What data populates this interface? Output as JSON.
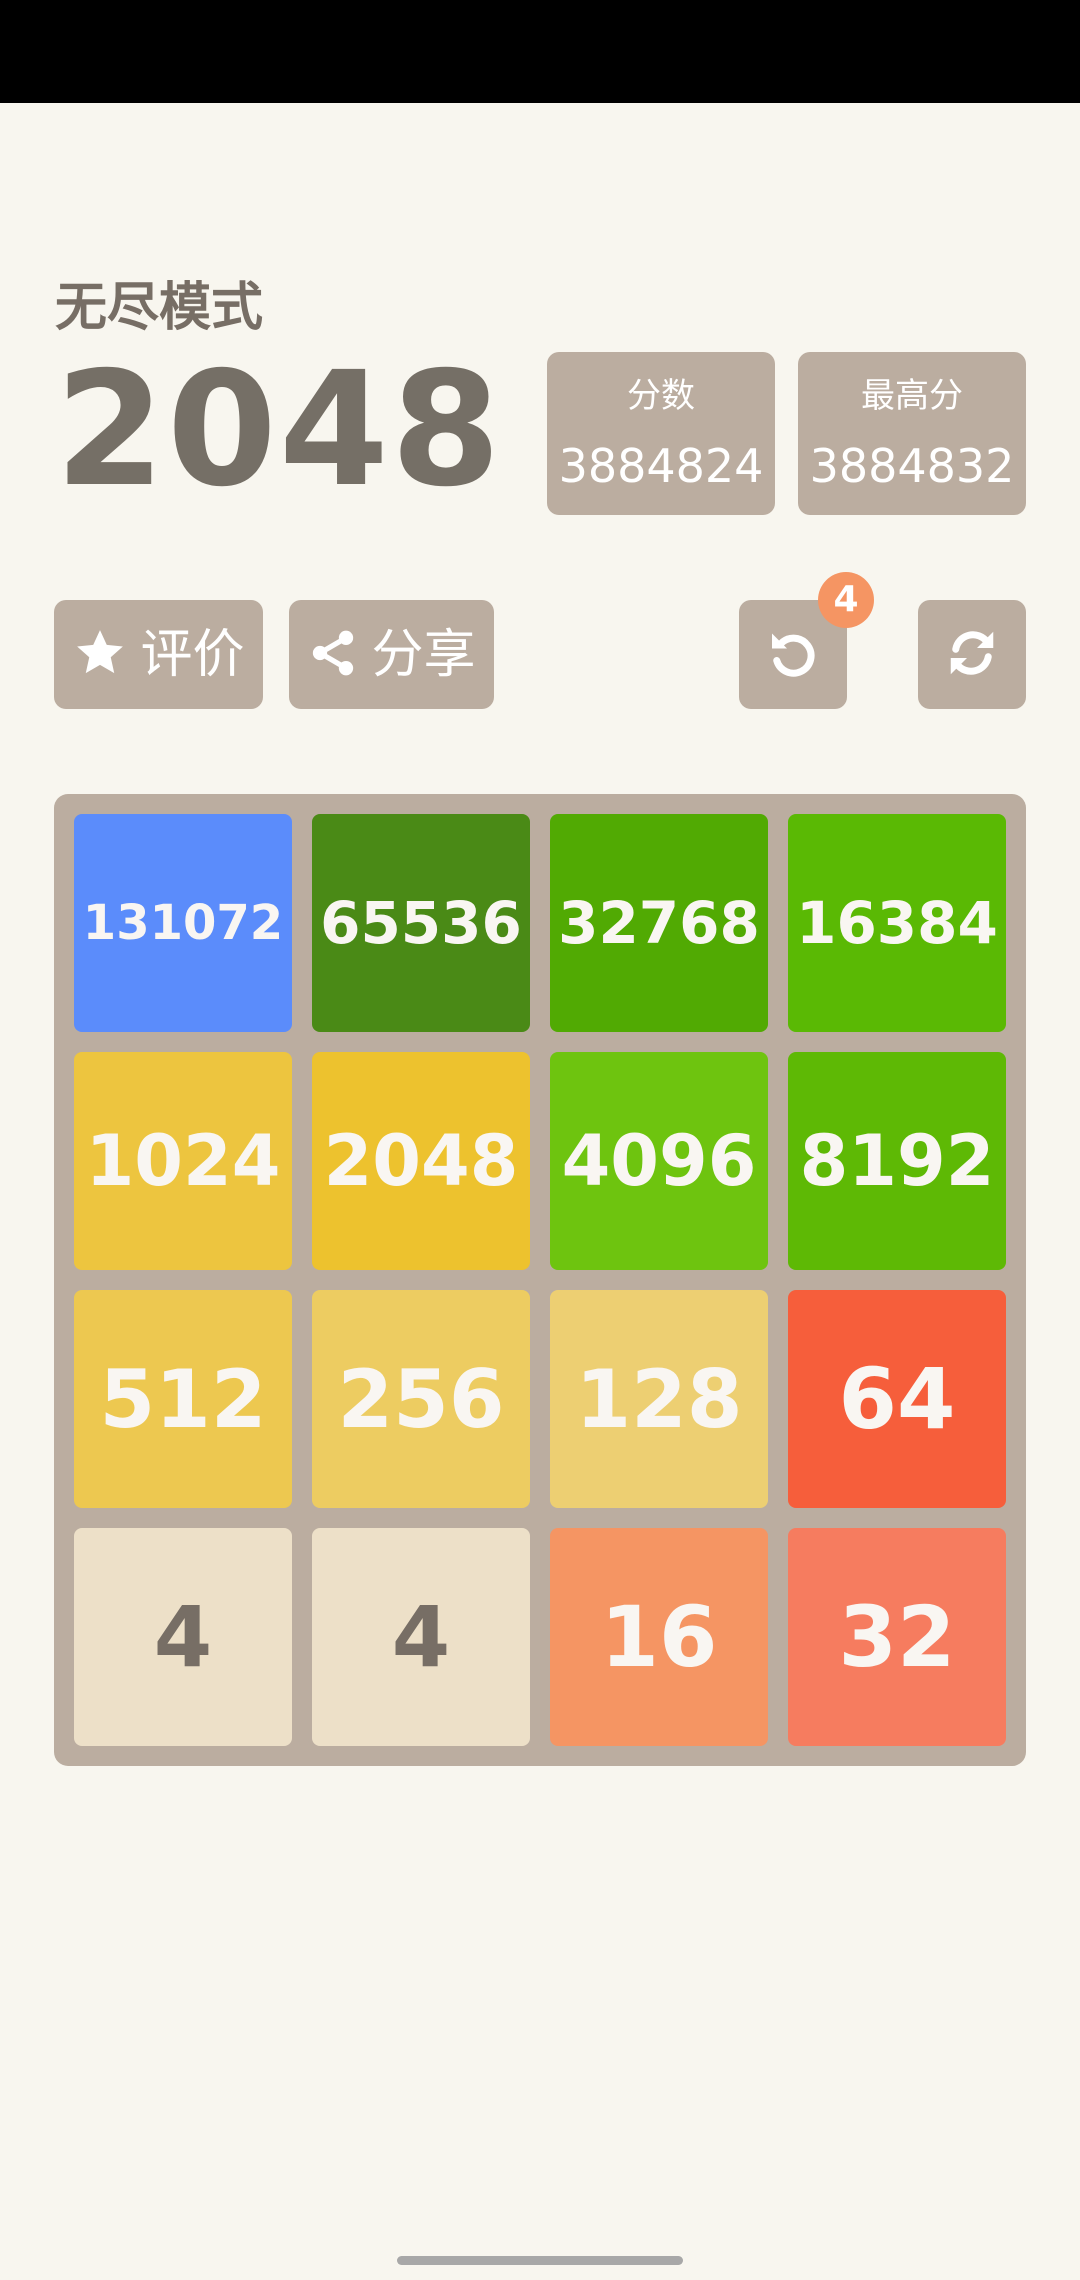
{
  "header": {
    "mode_label": "无尽模式",
    "title": "2048",
    "score": {
      "label": "分数",
      "value": "3884824"
    },
    "best": {
      "label": "最高分",
      "value": "3884832"
    }
  },
  "toolbar": {
    "rate_label": "评价",
    "share_label": "分享",
    "undo_badge": "4",
    "icons": [
      "star-icon",
      "share-icon",
      "undo-icon",
      "restart-icon"
    ]
  },
  "board": {
    "tiles": [
      {
        "value": "131072",
        "bg": "#5b8cfb",
        "fg": "#f9f6f2"
      },
      {
        "value": "65536",
        "bg": "#4a8a16",
        "fg": "#f9f6f2"
      },
      {
        "value": "32768",
        "bg": "#51aa03",
        "fg": "#f9f6f2"
      },
      {
        "value": "16384",
        "bg": "#5ab904",
        "fg": "#f9f6f2"
      },
      {
        "value": "1024",
        "bg": "#edc53f",
        "fg": "#f9f6f2"
      },
      {
        "value": "2048",
        "bg": "#edc22e",
        "fg": "#f9f6f2"
      },
      {
        "value": "4096",
        "bg": "#6ec40f",
        "fg": "#f9f6f2"
      },
      {
        "value": "8192",
        "bg": "#5eb905",
        "fg": "#f9f6f2"
      },
      {
        "value": "512",
        "bg": "#edc850",
        "fg": "#f9f6f2"
      },
      {
        "value": "256",
        "bg": "#edcc61",
        "fg": "#f9f6f2"
      },
      {
        "value": "128",
        "bg": "#edcf72",
        "fg": "#f9f6f2"
      },
      {
        "value": "64",
        "bg": "#f65e3b",
        "fg": "#f9f6f2"
      },
      {
        "value": "4",
        "bg": "#ede0c8",
        "fg": "#776e65"
      },
      {
        "value": "4",
        "bg": "#ede0c8",
        "fg": "#776e65"
      },
      {
        "value": "16",
        "bg": "#f59563",
        "fg": "#f9f6f2"
      },
      {
        "value": "32",
        "bg": "#f67c5f",
        "fg": "#f9f6f2"
      }
    ]
  }
}
